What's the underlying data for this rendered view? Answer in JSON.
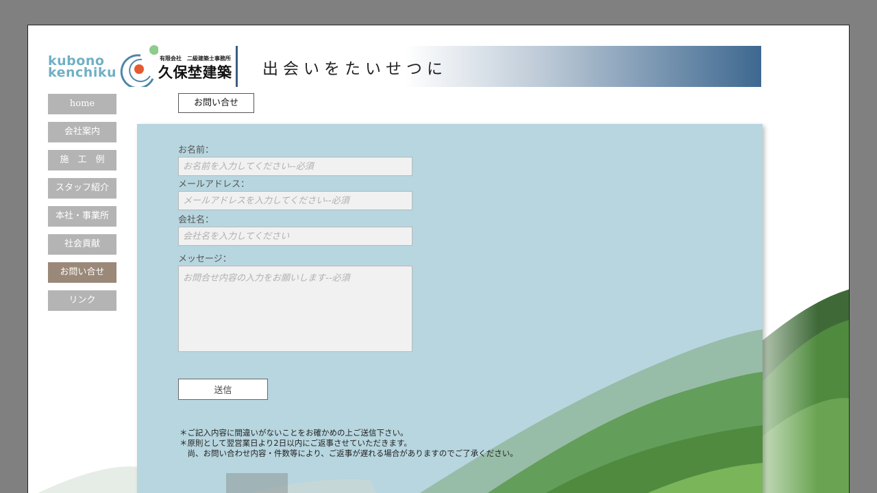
{
  "header": {
    "logo_line1": "kubono",
    "logo_line2": "kenchiku",
    "company_small": "有限会社　二級建築士事務所",
    "company_name": "久保埜建築",
    "tagline": "出会いをたいせつに"
  },
  "sidebar": {
    "items": [
      {
        "label": "home"
      },
      {
        "label": "会社案内"
      },
      {
        "label": "施　工　例"
      },
      {
        "label": "スタッフ紹介"
      },
      {
        "label": "本社・事業所"
      },
      {
        "label": "社会貢献"
      },
      {
        "label": "お問い合せ",
        "active": true
      },
      {
        "label": "リンク"
      }
    ]
  },
  "breadcrumb": "お問い合せ",
  "form": {
    "name_label": "お名前：",
    "name_placeholder": "お名前を入力してください--必須",
    "email_label": "メールアドレス：",
    "email_placeholder": "メールアドレスを入力してください--必須",
    "company_label": "会社名：",
    "company_placeholder": "会社名を入力してください",
    "message_label": "メッセージ：",
    "message_placeholder": "お問合せ内容の入力をお願いします--必須",
    "submit_label": "送信"
  },
  "notes": {
    "line1": "＊ご記入内容に間違いがないことをお確かめの上ご送信下さい。",
    "line2": "＊原則として翌営業日より2日以内にご返事させていただきます。",
    "line3": "　尚、お問い合わせ内容・件数等により、ご返事が遅れる場合がありますのでご了承ください。"
  },
  "colors": {
    "panel": "#b7d6df",
    "banner_dark": "#3e6890",
    "nav": "#b4b4b4",
    "nav_active": "#9a8878",
    "logo": "#6fb0c4"
  }
}
